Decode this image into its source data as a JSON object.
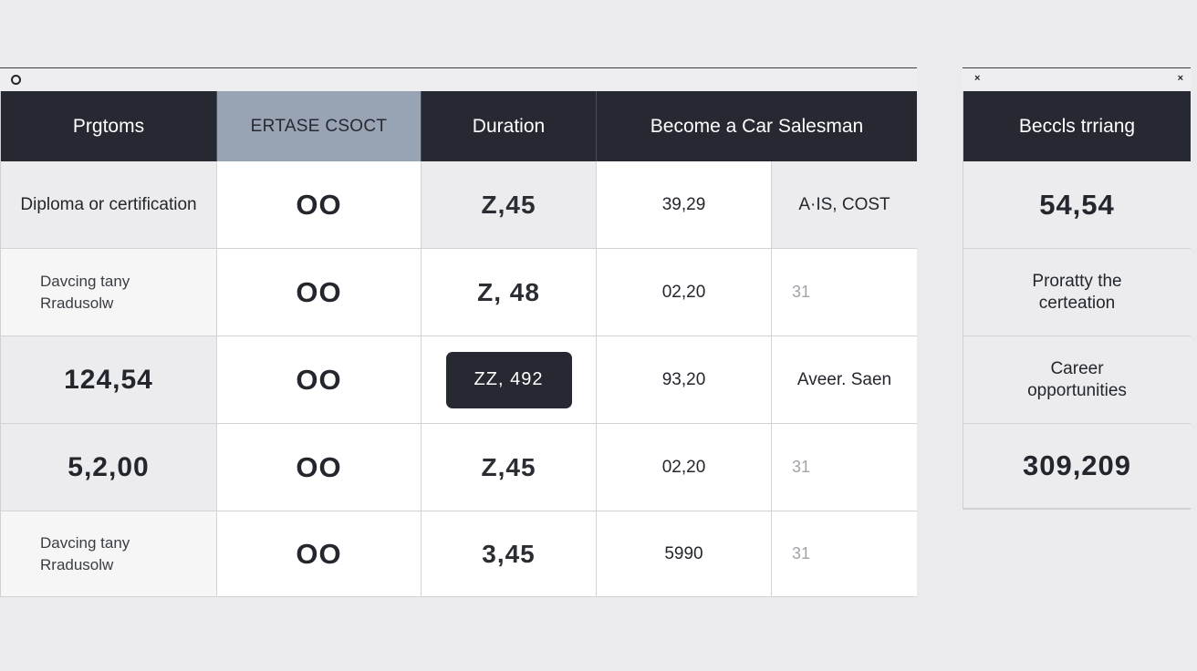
{
  "main_table": {
    "headers": [
      "Prgtoms",
      "ERTASE CSOCT",
      "Duration",
      "Become a Car Salesman"
    ],
    "rows": [
      {
        "label": "Diploma or certification",
        "col2": "OO",
        "col3": "Z,45",
        "col4": "39,29",
        "col5": "A·IS, COST"
      },
      {
        "label": "Davcing tany Rradusolw",
        "col2": "OO",
        "col3": "Z, 48",
        "col4": "02,20",
        "col5": "31"
      },
      {
        "label": "124,54",
        "col2": "OO",
        "col3": "ZZ, 492",
        "col4": "93,20",
        "col5": "Aveer. Saen"
      },
      {
        "label": "5,2,00",
        "col2": "OO",
        "col3": "Z,45",
        "col4": "02,20",
        "col5": "31"
      },
      {
        "label": "Davcing tany Rradusolw",
        "col2": "OO",
        "col3": "3,45",
        "col4": "5990",
        "col5": "31"
      }
    ]
  },
  "side_table": {
    "header": "Beccls trriang",
    "rows": [
      "54,54",
      "Proratty the certeation",
      "Career opportunities",
      "309,209"
    ]
  },
  "icons": {
    "main_window": "circle-icon",
    "side_window": [
      "close-icon",
      "close-icon"
    ]
  },
  "colors": {
    "header_dark": "#262931",
    "header_accent": "#98a3b4",
    "background": "#ebebed"
  }
}
